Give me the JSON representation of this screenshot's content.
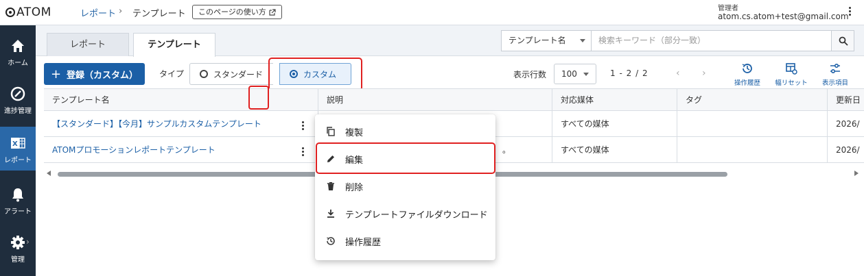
{
  "header": {
    "logo": "ATOM",
    "breadcrumb": [
      "レポート",
      "テンプレート"
    ],
    "help_button": "このページの使い方",
    "user_role": "管理者",
    "user_email": "atom.cs.atom+test@gmail.com"
  },
  "sidebar": {
    "items": [
      {
        "label": "ホーム",
        "icon": "home-icon"
      },
      {
        "label": "進捗管理",
        "icon": "progress-icon"
      },
      {
        "label": "レポート",
        "icon": "excel-report-icon",
        "active": true
      },
      {
        "label": "アラート",
        "icon": "bell-icon"
      },
      {
        "label": "管理",
        "icon": "gear-icon"
      }
    ]
  },
  "tabs": [
    {
      "label": "レポート",
      "active": false
    },
    {
      "label": "テンプレート",
      "active": true
    }
  ],
  "search": {
    "field_select": "テンプレート名",
    "placeholder": "検索キーワード（部分一致）"
  },
  "toolbar": {
    "register_label": "登録（カスタム）",
    "type_label": "タイプ",
    "type_options": [
      "スタンダード",
      "カスタム"
    ],
    "type_selected": "カスタム",
    "rows_label": "表示行数",
    "rows_value": "100",
    "pager_current": "1",
    "pager_sep1": "-",
    "pager_page": "2",
    "pager_sep2": "/",
    "pager_total": "2",
    "tools": [
      "操作履歴",
      "幅リセット",
      "表示項目"
    ]
  },
  "table": {
    "columns": [
      "テンプレート名",
      "説明",
      "対応媒体",
      "タグ",
      "更新日"
    ],
    "rows": [
      {
        "name": "【スタンダード】【今月】サンプルカスタムテンプレート",
        "description": "",
        "media": "すべての媒体",
        "tag": "",
        "updated": "2026/"
      },
      {
        "name": "ATOMプロモーションレポートテンプレート",
        "description": "。",
        "media": "すべての媒体",
        "tag": "",
        "updated": "2026/"
      }
    ]
  },
  "context_menu": {
    "items": [
      {
        "label": "複製",
        "icon": "copy-icon"
      },
      {
        "label": "編集",
        "icon": "pencil-icon"
      },
      {
        "label": "削除",
        "icon": "trash-icon"
      },
      {
        "label": "テンプレートファイルダウンロード",
        "icon": "download-icon"
      },
      {
        "label": "操作履歴",
        "icon": "history-icon"
      }
    ]
  },
  "colors": {
    "accent": "#1b5fa6",
    "sidebar_bg": "#1f2d3d",
    "sidebar_active": "#2a68a8",
    "highlight": "#e02020"
  }
}
